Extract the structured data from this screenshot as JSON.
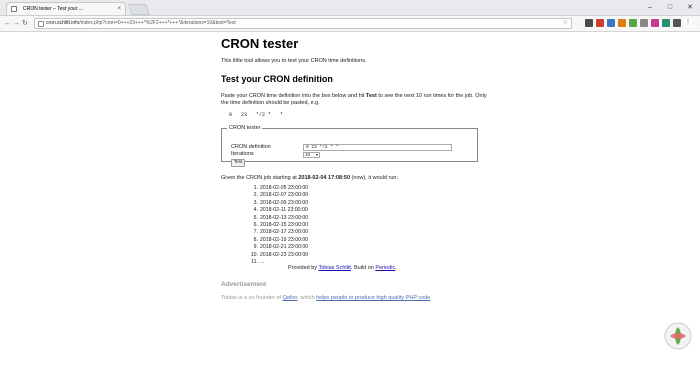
{
  "browser": {
    "tab_title": "CRON tester – Test your ...",
    "url_host": "cron.schlitt.info",
    "url_path": "/index.php?cron=0+++23+++*%2F2+++*+++*&iterations=10&test=Test",
    "window_controls": [
      "–",
      "□",
      "✕"
    ]
  },
  "page": {
    "title": "CRON tester",
    "intro": "This little tool allows you to test your CRON time definitions.",
    "section_heading": "Test your CRON definition",
    "instructions_pre": "Paste your CRON time definition into the box below and hit ",
    "instructions_bold": "Test",
    "instructions_post": " to see the next 10 run times for the job. Only the time definition should be pasted, e.g.",
    "example": "0   23   */2 *   *"
  },
  "form": {
    "legend": "CRON tester",
    "cron_label": "CRON definition",
    "cron_value": "0   23  */2 *   *",
    "iterations_label": "Iterations",
    "iterations_value": "10",
    "test_button": "Test"
  },
  "results": {
    "intro_pre": "Given the CRON job starting at ",
    "start_time": "2018-02-04 17:08:50",
    "intro_post": " (now), it would run:",
    "runs": [
      {
        "num": "1.",
        "time": "2018-02-05 23:00:00"
      },
      {
        "num": "2.",
        "time": "2018-02-07 23:00:00"
      },
      {
        "num": "3.",
        "time": "2018-02-09 23:00:00"
      },
      {
        "num": "4.",
        "time": "2018-02-11 23:00:00"
      },
      {
        "num": "5.",
        "time": "2018-02-13 23:00:00"
      },
      {
        "num": "6.",
        "time": "2018-02-15 23:00:00"
      },
      {
        "num": "7.",
        "time": "2018-02-17 23:00:00"
      },
      {
        "num": "8.",
        "time": "2018-02-19 23:00:00"
      },
      {
        "num": "9.",
        "time": "2018-02-21 23:00:00"
      },
      {
        "num": "10.",
        "time": "2018-02-23 23:00:00"
      },
      {
        "num": "11.",
        "time": "..."
      }
    ]
  },
  "footer": {
    "provided_pre": "Provided by ",
    "author": "Tobias Schlitt",
    "provided_mid": ". Build on ",
    "framework": "Periodic",
    "provided_post": ".",
    "advertisement": "Advertisement",
    "ad_pre": "Tobias is a co-founder of ",
    "company": "Qafoo",
    "ad_mid": ", which ",
    "ad_link": "helps people to produce high quality PHP code",
    "ad_post": "."
  },
  "colors": {
    "link": "#1a0dab",
    "muted": "#999999"
  }
}
